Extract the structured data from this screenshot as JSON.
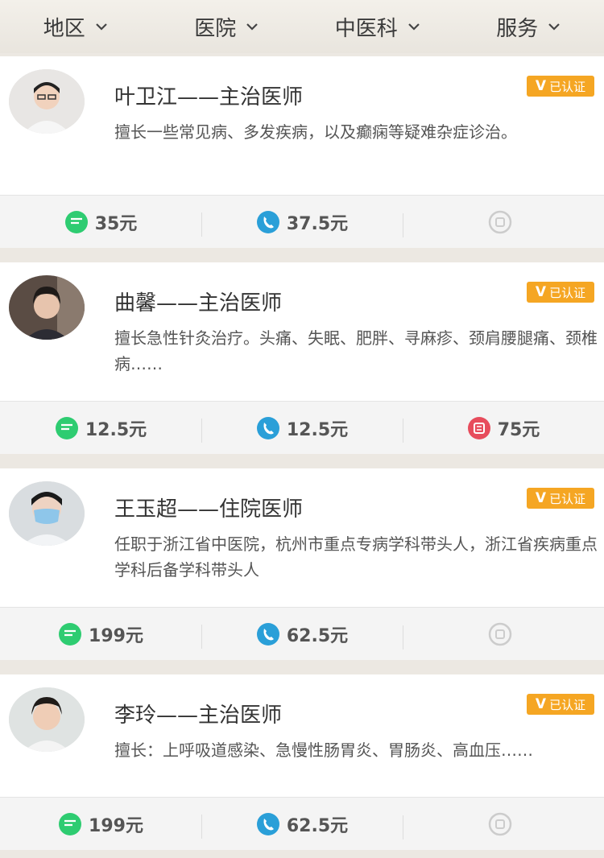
{
  "filters": [
    {
      "label": "地区"
    },
    {
      "label": "医院"
    },
    {
      "label": "中医科"
    },
    {
      "label": "服务"
    }
  ],
  "verified_label": "已认证",
  "doctors": [
    {
      "name": "叶卫江——主治医师",
      "desc": "擅长一些常见病、多发疾病，以及癫痫等疑难杂症诊治。",
      "text_price": "35元",
      "phone_price": "37.5元",
      "video_price": ""
    },
    {
      "name": "曲馨——主治医师",
      "desc": "擅长急性针灸治疗。头痛、失眠、肥胖、寻麻疹、颈肩腰腿痛、颈椎病……",
      "text_price": "12.5元",
      "phone_price": "12.5元",
      "video_price": "75元"
    },
    {
      "name": "王玉超——住院医师",
      "desc": "任职于浙江省中医院，杭州市重点专病学科带头人，浙江省疾病重点学科后备学科带头人",
      "text_price": "199元",
      "phone_price": "62.5元",
      "video_price": ""
    },
    {
      "name": "李玲——主治医师",
      "desc": "擅长：上呼吸道感染、急慢性肠胃炎、胃肠炎、高血压……",
      "text_price": "199元",
      "phone_price": "62.5元",
      "video_price": ""
    }
  ],
  "colors": {
    "chat": "#2ecc71",
    "phone": "#2a9fd8",
    "video_active": "#e74c5c",
    "video_inactive": "#cccccc",
    "verified": "#f5a623"
  }
}
